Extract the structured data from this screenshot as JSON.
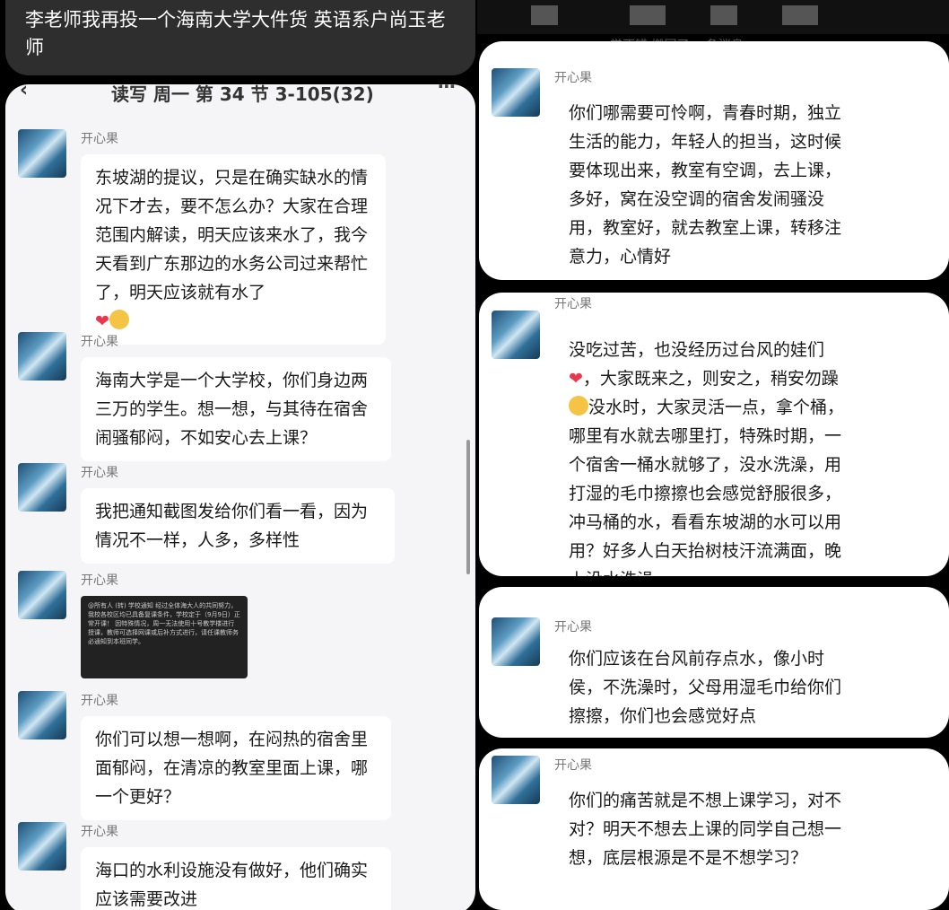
{
  "caption": "李老师我再投一个海南大学大件货 英语系户尚玉老师",
  "left": {
    "header_title": "读写 周一 第 34 节 3-105(32)",
    "messages": [
      {
        "sender": "开心果",
        "text": "东坡湖的提议，只是在确实缺水的情况下才去，要不怎么办？大家在合理范围内解读，明天应该来水了，我今天看到广东那边的水务公司过来帮忙了，明天应该就有水了"
      },
      {
        "sender": "开心果",
        "text": "海南大学是一个大学校，你们身边两三万的学生。想一想，与其待在宿舍闹骚郁闷，不如安心去上课？"
      },
      {
        "sender": "开心果",
        "text": "我把通知截图发给你们看一看，因为情况不一样，人多，多样性"
      },
      {
        "sender": "开心果",
        "image_text": "@所有人 (转) 学校通知 经过全体海大人的共同努力，我校各校区均已具备复课条件，学校定于（9月9日）正常开课！ 因特殊情况，周一无法使用十号教学楼进行授课，教师可选择网课或后补方式进行，请任课教师务必通知到本班同学。"
      },
      {
        "sender": "开心果",
        "text": "你们可以想一想啊，在闷热的宿舍里面郁闷，在清凉的教室里面上课，哪一个更好？"
      },
      {
        "sender": "开心果",
        "text": "海口的水利设施没有做好，他们确实应该需要改进"
      }
    ]
  },
  "right": {
    "partial_header": "学不错 搬回了 一条消息",
    "messages": [
      {
        "sender": "开心果",
        "text": "你们哪需要可怜啊，青春时期，独立生活的能力，年轻人的担当，这时候要体现出来，教室有空调，去上课，多好，窝在没空调的宿舍发闹骚没用，教室好，就去教室上课，转移注意力，心情好"
      },
      {
        "sender": "开心果",
        "text_a": "没吃过苦，也没经历过台风的娃们",
        "text_b": "，大家既来之，则安之，稍安勿躁",
        "text_c": "没水时，大家灵活一点，拿个桶，哪里有水就去哪里打，特殊时期，一个宿舍一桶水就够了，没水洗澡，用打湿的毛巾擦擦也会感觉舒服很多，冲马桶的水，看看东坡湖的水可以用用？好多人白天抬树枝汗流满面，晚上没水洗澡"
      },
      {
        "sender": "开心果",
        "text": "你们应该在台风前存点水，像小时侯，不洗澡时，父母用湿毛巾给你们擦擦，你们也会感觉好点"
      },
      {
        "sender": "开心果",
        "text": "你们的痛苦就是不想上课学习，对不对？明天不想去上课的同学自己想一想，底层根源是不是不想学习？"
      }
    ]
  },
  "icons": {
    "heart": "❤",
    "back": "‹",
    "more": "⋯"
  }
}
